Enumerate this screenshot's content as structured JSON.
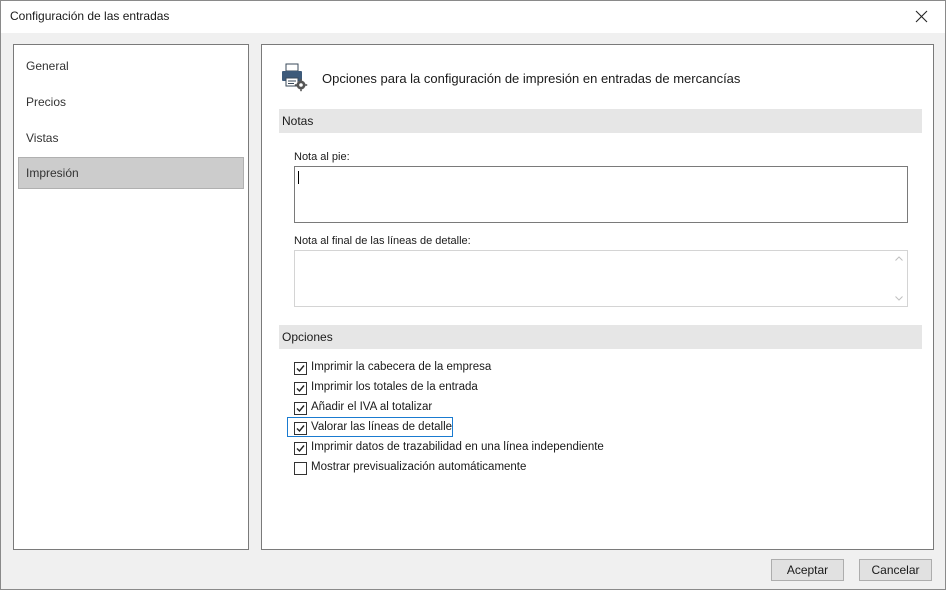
{
  "window": {
    "title": "Configuración de las entradas",
    "close_icon": "close-icon"
  },
  "sidebar": {
    "items": [
      {
        "label": "General",
        "selected": false
      },
      {
        "label": "Precios",
        "selected": false
      },
      {
        "label": "Vistas",
        "selected": false
      },
      {
        "label": "Impresión",
        "selected": true
      }
    ]
  },
  "main": {
    "header_icon": "printer-settings-icon",
    "header_text": "Opciones para la configuración de impresión en entradas de mercancías",
    "notas": {
      "section_title": "Notas",
      "nota_pie_label": "Nota al pie:",
      "nota_pie_value": "",
      "nota_final_label": "Nota al final de las líneas de detalle:",
      "nota_final_value": ""
    },
    "opciones": {
      "section_title": "Opciones",
      "checkboxes": [
        {
          "label": "Imprimir la cabecera de la empresa",
          "checked": true
        },
        {
          "label": "Imprimir los totales de la entrada",
          "checked": true
        },
        {
          "label": "Añadir el IVA al totalizar",
          "checked": true
        },
        {
          "label": "Valorar las líneas de detalle",
          "checked": true,
          "focused": true
        },
        {
          "label": "Imprimir datos de trazabilidad en una línea independiente",
          "checked": true
        },
        {
          "label": "Mostrar previsualización automáticamente",
          "checked": false
        }
      ]
    }
  },
  "footer": {
    "accept_label": "Aceptar",
    "cancel_label": "Cancelar"
  },
  "colors": {
    "selected_bg": "#cccccc",
    "focus_border": "#1a7bd0",
    "section_bg": "#e6e6e6"
  }
}
